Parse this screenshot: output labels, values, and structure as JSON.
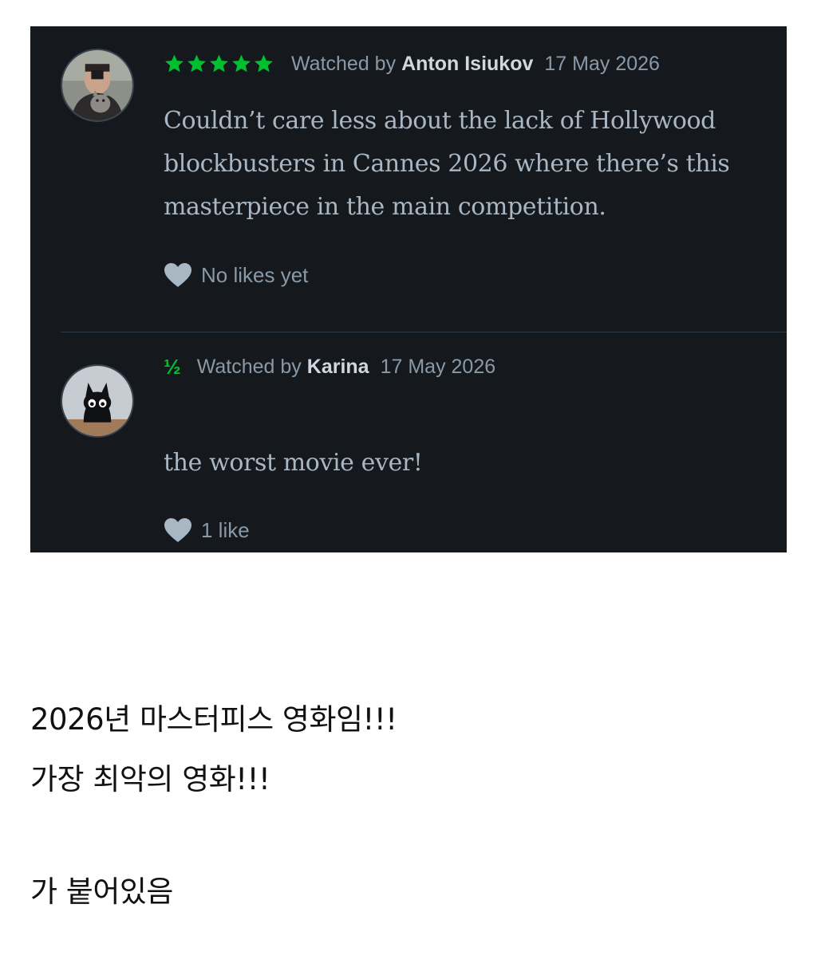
{
  "reviews": [
    {
      "rating_icon": "five-stars",
      "rating_value": 5,
      "watched_label": "Watched by",
      "author": "Anton Isiukov",
      "date": "17 May 2026",
      "text": "Couldn’t care less about the lack of Hollywood blockbusters in Cannes 2026 where there’s this masterpiece in the main competition.",
      "likes": "No likes yet"
    },
    {
      "rating_icon": "half-star",
      "rating_text": "½",
      "watched_label": "Watched by",
      "author": "Karina",
      "date": "17 May 2026",
      "text": "the worst movie ever!",
      "likes": "1 like"
    }
  ],
  "captions": [
    "2026년 마스터피스 영화임!!!",
    "가장 최악의 영화!!!",
    "가 붙어있음"
  ],
  "colors": {
    "panel_bg": "#15191e",
    "star_green": "#00c030",
    "meta_text": "#8a99a8",
    "body_text": "#a9b6c3",
    "author_text": "#cfd8e1",
    "heart": "#a9b6c3"
  }
}
